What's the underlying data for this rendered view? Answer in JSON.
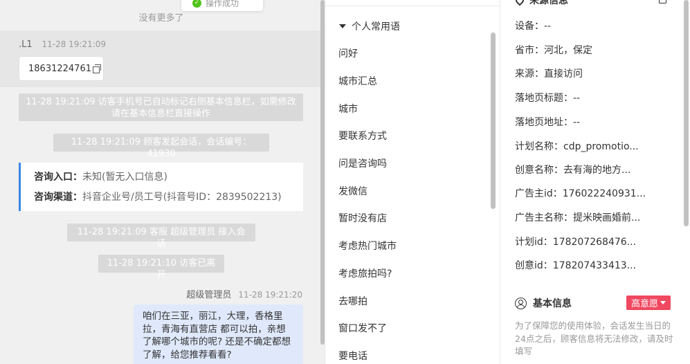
{
  "toast": {
    "text": "操作成功"
  },
  "chat": {
    "no_more": "没有更多了",
    "visitor": {
      "name": ".L1",
      "time": "11-28 19:21:09",
      "phone": "18631224761"
    },
    "system_messages": [
      "11-28 19:21:09 访客手机号已自动标记右侧基本信息栏，如需修改请在基本信息栏直接操作",
      "11-28 19:21:09 顾客发起会话，会话编号：41930",
      "11-28 19:21:09 客服 超级管理员 接入会话",
      "11-28 19:21:10 访客已离开"
    ],
    "consult": {
      "entry_label": "咨询入口：",
      "entry_value": "未知(暂无入口信息)",
      "channel_label": "咨询渠道：",
      "channel_value": "抖音企业号/员工号(抖音号ID：2839502213)"
    },
    "agent": {
      "name": "超级管理员",
      "time": "11-28 19:21:20",
      "message": "咱们在三亚，丽江，大理，香格里拉，青海有直营店 都可以拍，亲想了解哪个城市的呢? 还是不确定都想了解，给您推荐看看?"
    }
  },
  "phrases": {
    "group_title": "个人常用语",
    "items": [
      "问好",
      "城市汇总",
      "城市",
      "要联系方式",
      "问是咨询吗",
      "发微信",
      "暂时没有店",
      "考虑热门城市",
      "考虑旅拍吗?",
      "去哪拍",
      "窗口发不了",
      "要电话"
    ]
  },
  "info": {
    "source_title": "来源信息",
    "rows": [
      "设备：--",
      "省市：河北，保定",
      "来源：直接访问",
      "落地页标题：--",
      "落地页地址：--",
      "计划名称：cdp_promotio...",
      "创意名称：去有海的地方...",
      "广告主id：176022240931...",
      "广告主名称：提米映画婚前...",
      "计划id：178207268476...",
      "创意id：178207433413..."
    ],
    "basic_title": "基本信息",
    "intent_badge": "高意愿",
    "notice": "为了保障您的使用体验，会话发生当日的24点之后，顾客信息将无法修改，请及时填写"
  },
  "colors": {
    "accent_blue": "#3b87e5",
    "badge_red": "#f04860",
    "agent_bubble": "#dfe9fb"
  }
}
